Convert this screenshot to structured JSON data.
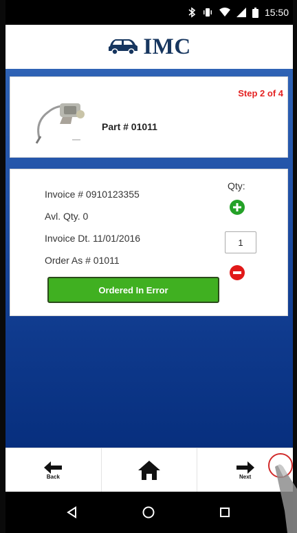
{
  "status_bar": {
    "time": "15:50",
    "icons": [
      "bluetooth-icon",
      "vibrate-icon",
      "wifi-icon",
      "signal-icon",
      "battery-icon"
    ]
  },
  "header": {
    "brand": "IMC",
    "logo_icon": "car-icon",
    "brand_color": "#17365f"
  },
  "part_card": {
    "step": "Step 2 of 4",
    "part_number": "Part # 01011",
    "step_color": "#e42222"
  },
  "invoice_card": {
    "invoice_number": "Invoice # 0910123355",
    "avl_qty": "Avl. Qty. 0",
    "invoice_date": "Invoice Dt. 11/01/2016",
    "order_as": "Order As # 01011",
    "qty_label": "Qty:",
    "qty_value": "1",
    "ordered_in_error_label": "Ordered In Error",
    "button_color": "#40b021"
  },
  "bottom_nav": {
    "back_label": "Back",
    "next_label": "Next",
    "home_icon": "home-icon"
  },
  "system_nav": {
    "icons": [
      "back-triangle-icon",
      "home-circle-icon",
      "recents-square-icon"
    ]
  }
}
